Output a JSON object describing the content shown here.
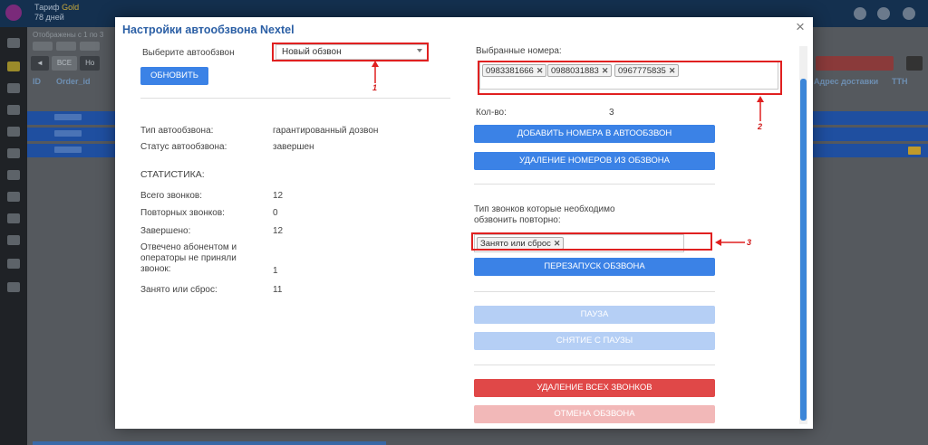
{
  "background_app": {
    "tariff_label": "Тариф",
    "tariff_value": "Gold",
    "days_left": "78 дней",
    "subheader": "Отображены с 1 по 3",
    "tabs": [
      "ВСЕ",
      "Но"
    ],
    "columns": [
      "ID",
      "Order_id",
      "Адрес доставки",
      "ТТН"
    ]
  },
  "modal": {
    "title": "Настройки автообзвона Nextel",
    "close_glyph": "×",
    "left": {
      "select_label": "Выберите автообзвон",
      "select_value": "Новый обзвон",
      "refresh_button": "ОБНОВИТЬ",
      "type_label": "Тип автообзвона:",
      "type_value": "гарантированный дозвон",
      "status_label": "Статус автообзвона:",
      "status_value": "завершен",
      "stats_title": "СТАТИСТИКА:",
      "stats": {
        "total_label": "Всего звонков:",
        "total_value": "12",
        "repeat_label": "Повторных звонков:",
        "repeat_value": "0",
        "done_label": "Завершено:",
        "done_value": "12",
        "answered_label": "Отвечено абонентом и операторы не приняли звонок:",
        "answered_value": "1",
        "busy_label": "Занято или сброс:",
        "busy_value": "11"
      }
    },
    "right": {
      "numbers_label": "Выбранные номера:",
      "numbers": [
        "0983381666",
        "0988031883",
        "0967775835"
      ],
      "count_label": "Кол-во:",
      "count_value": "3",
      "add_button": "ДОБАВИТЬ НОМЕРА В АВТООБЗВОН",
      "remove_button": "УДАЛЕНИЕ НОМЕРОВ ИЗ ОБЗВОНА",
      "retry_type_label": "Тип звонков которые необходимо обзвонить повторно:",
      "retry_types": [
        "Занято или сброс"
      ],
      "restart_button": "ПЕРЕЗАПУСК ОБЗВОНА",
      "pause_button": "ПАУЗА",
      "unpause_button": "СНЯТИЕ С ПАУЗЫ",
      "delete_all_button": "УДАЛЕНИЕ ВСЕХ ЗВОНКОВ",
      "cancel_button": "ОТМЕНА ОБЗВОНА"
    }
  },
  "annotations": {
    "one": "1",
    "two": "2",
    "three": "3",
    "color": "#e02020"
  }
}
